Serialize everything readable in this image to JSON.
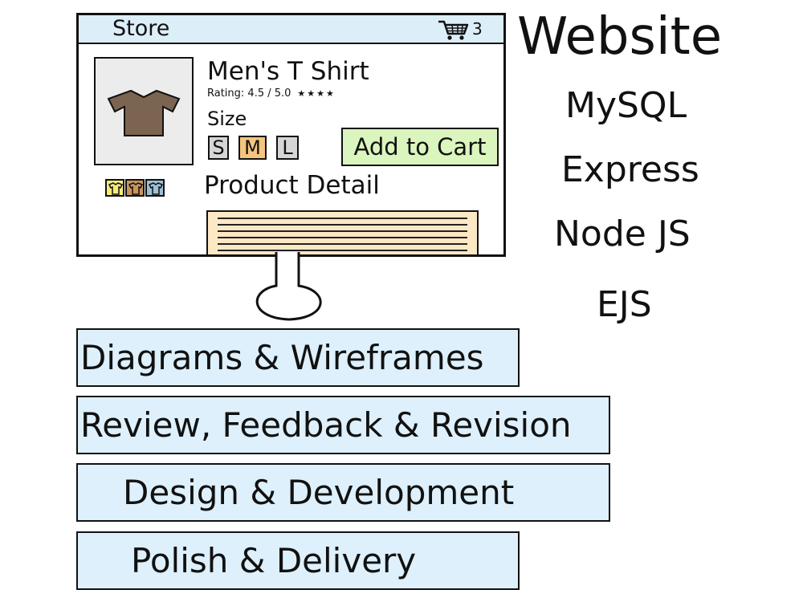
{
  "store": {
    "label": "Store",
    "cart_icon": "cart-icon",
    "cart_count": "3"
  },
  "product": {
    "title": "Men's T Shirt",
    "rating_text": "Rating: 4.5 / 5.0",
    "rating_stars": "★★★★",
    "size_label": "Size",
    "sizes": [
      {
        "label": "S",
        "selected": false
      },
      {
        "label": "M",
        "selected": true
      },
      {
        "label": "L",
        "selected": false
      }
    ],
    "add_to_cart_label": "Add to Cart",
    "detail_heading": "Product Detail",
    "shirt_icon": "tshirt-icon",
    "shirt_color": "#7b6450",
    "thumbnail_colors": [
      "#f6ec7a",
      "#c9955a",
      "#9cc0d6"
    ]
  },
  "stack": {
    "title": "Website",
    "items": [
      "MySQL",
      "Express",
      "Node JS",
      "EJS"
    ]
  },
  "process": {
    "steps": [
      "Diagrams & Wireframes",
      "Review, Feedback & Revision",
      "Design & Development",
      "Polish & Delivery"
    ]
  },
  "colors": {
    "titlebar": "#dceef8",
    "add_to_cart": "#daf5bd",
    "selected_size": "#f5c57e",
    "detail_box": "#fde8c4",
    "process_box": "#ddf0fb"
  }
}
